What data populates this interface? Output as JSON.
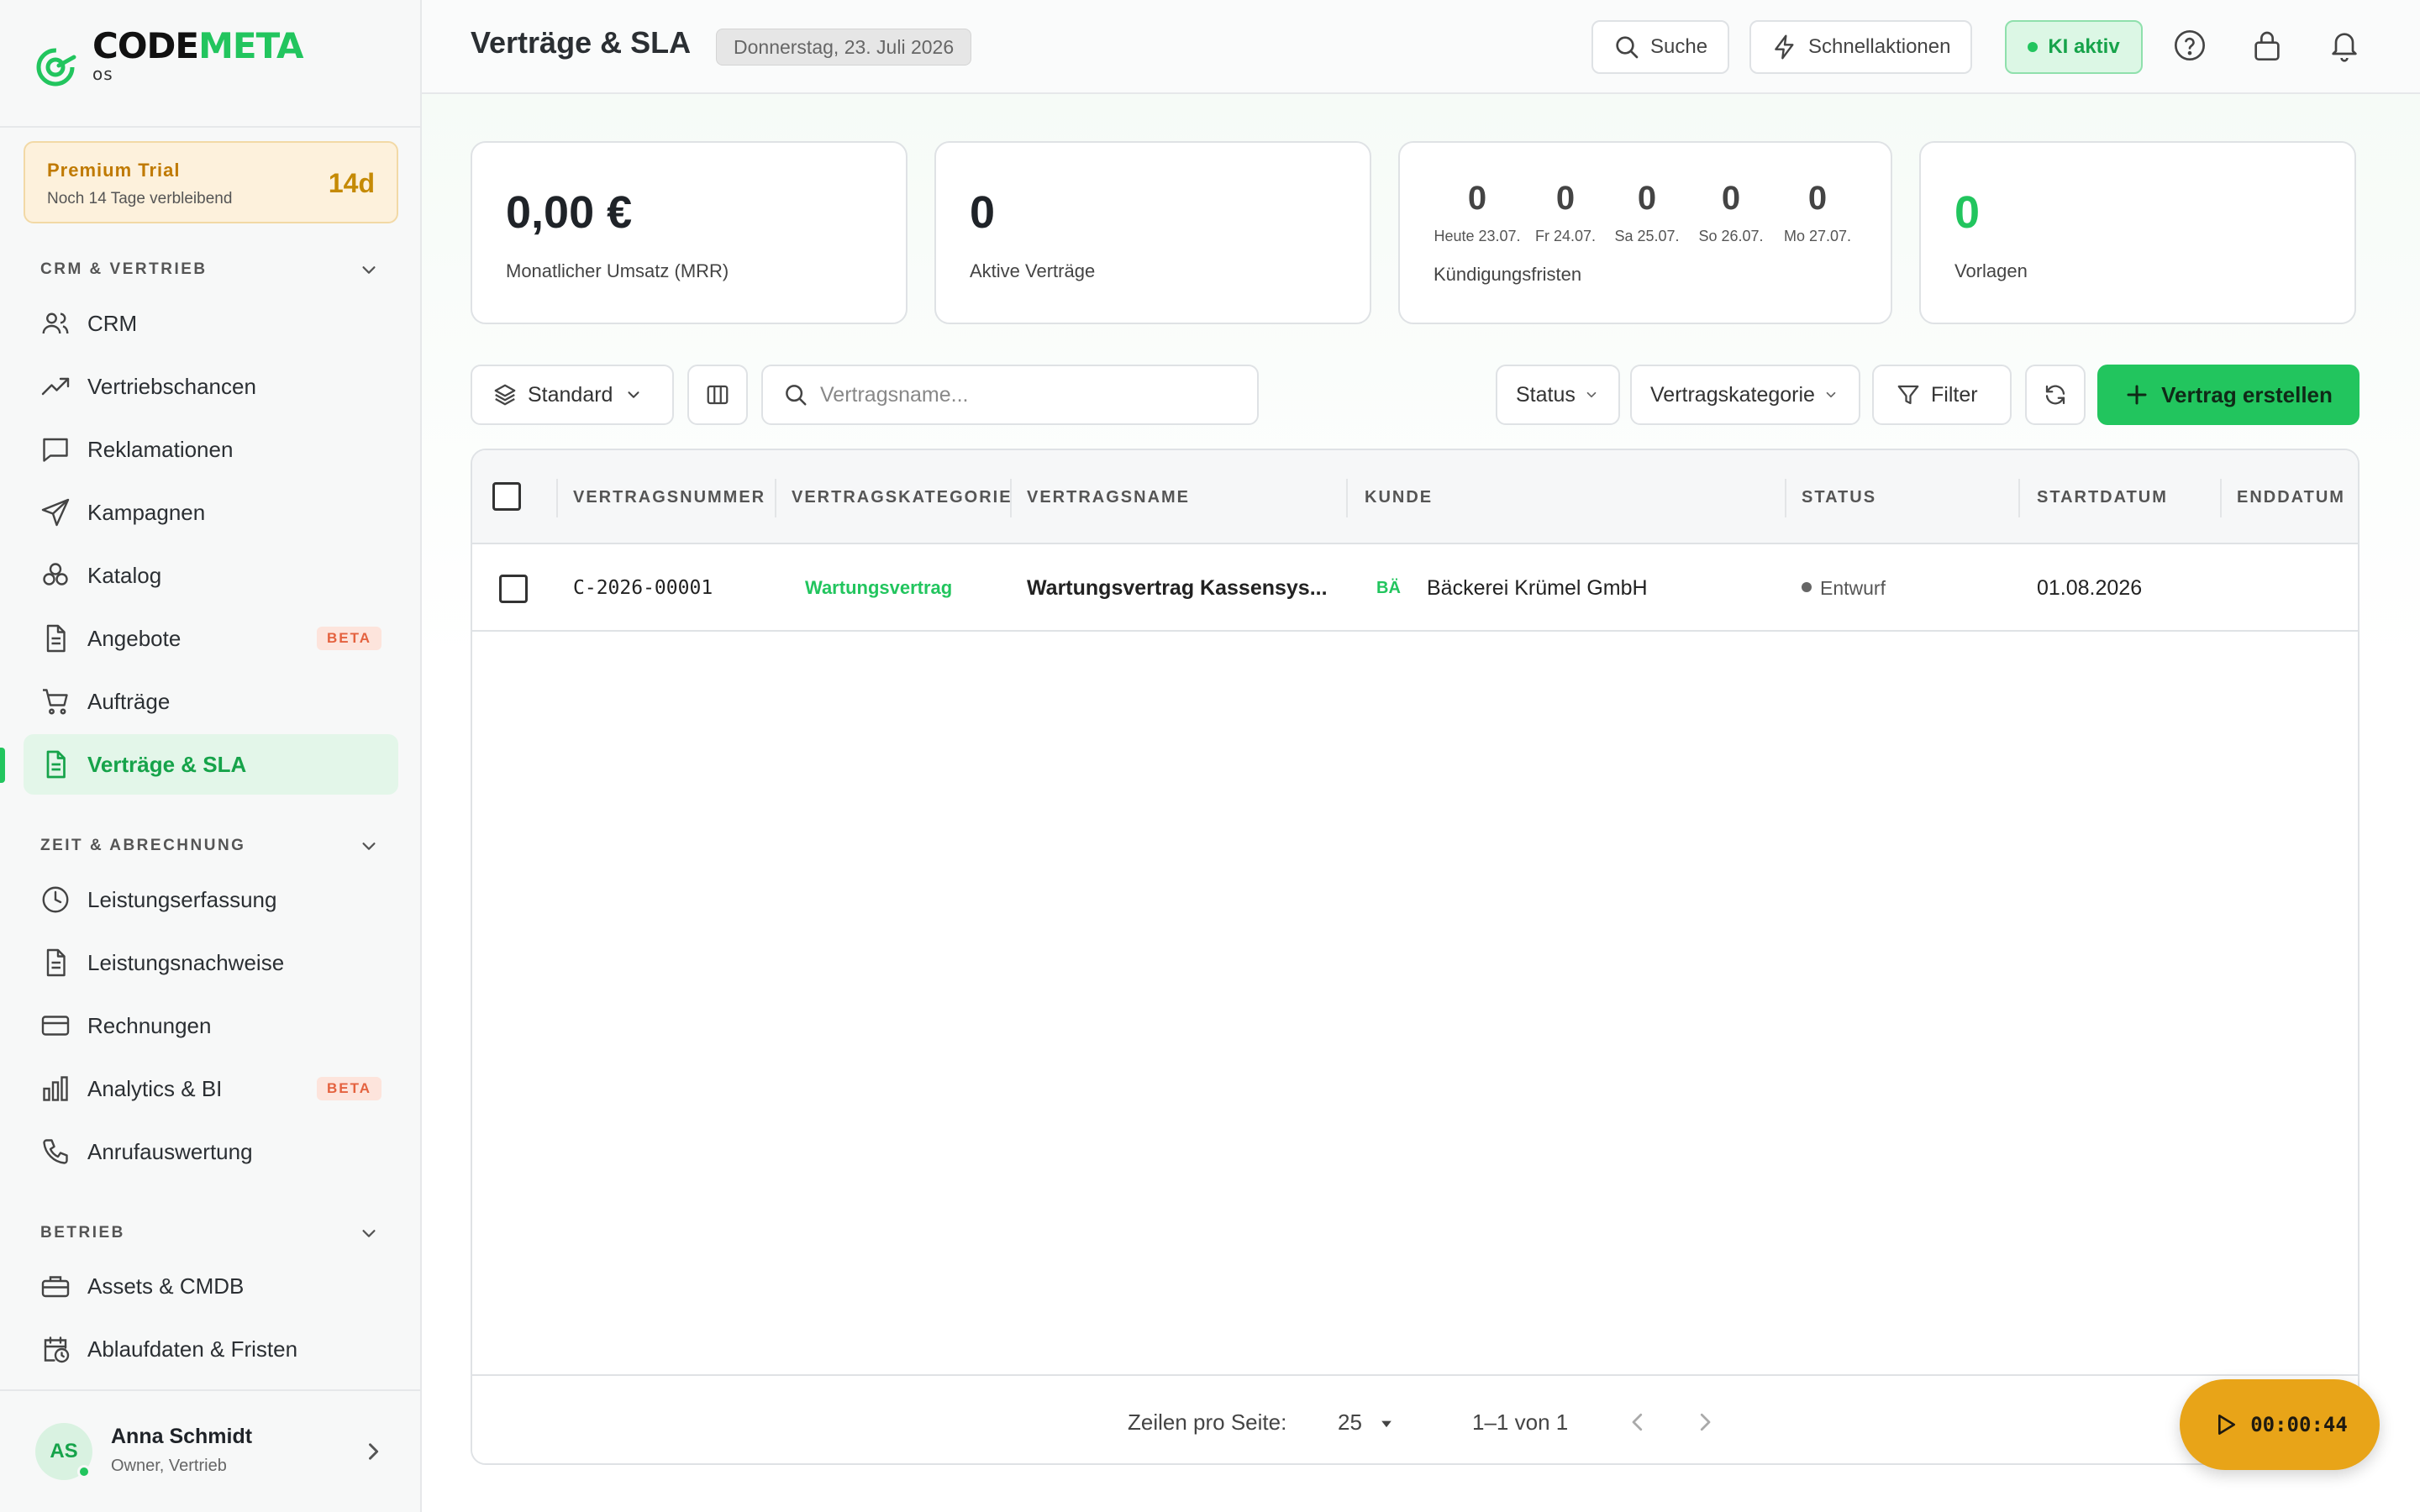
{
  "app": {
    "logo_code": "CODE",
    "logo_meta": "META",
    "logo_sub": "OS"
  },
  "trial": {
    "title": "Premium Trial",
    "subtitle": "Noch 14 Tage verbleibend",
    "days": "14d"
  },
  "sidebar": {
    "sections": [
      {
        "title": "CRM & VERTRIEB",
        "items": [
          {
            "label": "CRM",
            "icon": "users-icon"
          },
          {
            "label": "Vertriebschancen",
            "icon": "trending-up-icon"
          },
          {
            "label": "Reklamationen",
            "icon": "message-icon"
          },
          {
            "label": "Kampagnen",
            "icon": "send-icon"
          },
          {
            "label": "Katalog",
            "icon": "boxes-icon"
          },
          {
            "label": "Angebote",
            "icon": "file-icon",
            "badge": "BETA"
          },
          {
            "label": "Aufträge",
            "icon": "cart-icon"
          },
          {
            "label": "Verträge & SLA",
            "icon": "contract-icon",
            "active": true
          }
        ]
      },
      {
        "title": "ZEIT & ABRECHNUNG",
        "items": [
          {
            "label": "Leistungserfassung",
            "icon": "clock-icon"
          },
          {
            "label": "Leistungsnachweise",
            "icon": "file-text-icon"
          },
          {
            "label": "Rechnungen",
            "icon": "credit-card-icon"
          },
          {
            "label": "Analytics & BI",
            "icon": "bar-chart-icon",
            "badge": "BETA"
          },
          {
            "label": "Anrufauswertung",
            "icon": "phone-icon"
          }
        ]
      },
      {
        "title": "BETRIEB",
        "items": [
          {
            "label": "Assets & CMDB",
            "icon": "briefcase-icon"
          },
          {
            "label": "Ablaufdaten & Fristen",
            "icon": "calendar-clock-icon"
          }
        ]
      }
    ]
  },
  "user": {
    "initials": "AS",
    "name": "Anna Schmidt",
    "role": "Owner, Vertrieb"
  },
  "header": {
    "title": "Verträge & SLA",
    "date": "Donnerstag, 23. Juli 2026",
    "search_label": "Suche",
    "quick_label": "Schnellaktionen",
    "ki_label": "KI aktiv"
  },
  "stats": {
    "mrr_value": "0,00 €",
    "mrr_label": "Monatlicher Umsatz (MRR)",
    "active_value": "0",
    "active_label": "Aktive Verträge",
    "deadlines_label": "Kündigungsfristen",
    "deadlines": [
      {
        "count": "0",
        "day": "Heute 23.07."
      },
      {
        "count": "0",
        "day": "Fr 24.07."
      },
      {
        "count": "0",
        "day": "Sa 25.07."
      },
      {
        "count": "0",
        "day": "So 26.07."
      },
      {
        "count": "0",
        "day": "Mo 27.07."
      }
    ],
    "templates_value": "0",
    "templates_label": "Vorlagen"
  },
  "toolbar": {
    "view_label": "Standard",
    "search_placeholder": "Vertragsname...",
    "status_label": "Status",
    "category_label": "Vertragskategorie",
    "filter_label": "Filter",
    "create_label": "Vertrag erstellen"
  },
  "table": {
    "columns": [
      "VERTRAGSNUMMER",
      "VERTRAGSKATEGORIE",
      "VERTRAGSNAME",
      "KUNDE",
      "STATUS",
      "STARTDATUM",
      "ENDDATUM"
    ],
    "rows": [
      {
        "number": "C-2026-00001",
        "category": "Wartungsvertrag",
        "name": "Wartungsvertrag Kassensys...",
        "customer_initials": "BÄ",
        "customer": "Bäckerei Krümel GmbH",
        "status": "Entwurf",
        "start": "01.08.2026",
        "end": ""
      }
    ]
  },
  "pagination": {
    "rows_label": "Zeilen pro Seite:",
    "rows_value": "25",
    "range": "1–1 von 1"
  },
  "timer": {
    "time": "00:00:44"
  },
  "colors": {
    "accent": "#22c55e",
    "trial": "#c58a05",
    "timer": "#e8a418",
    "beta": "#e4623f"
  }
}
